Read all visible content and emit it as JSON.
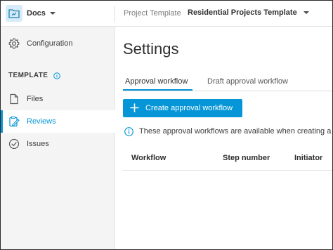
{
  "header": {
    "app_label": "Docs",
    "project_label": "Project Template",
    "project_name": "Residential Projects Template"
  },
  "sidebar": {
    "items": [
      {
        "label": "Configuration",
        "icon": "gear-icon"
      },
      {
        "label": "Files",
        "icon": "file-icon"
      },
      {
        "label": "Reviews",
        "icon": "review-icon",
        "active": true
      },
      {
        "label": "Issues",
        "icon": "check-circle-icon"
      }
    ],
    "section_label": "TEMPLATE"
  },
  "main": {
    "title": "Settings",
    "tabs": [
      {
        "label": "Approval workflow",
        "active": true
      },
      {
        "label": "Draft approval workflow"
      }
    ],
    "create_button_label": "Create approval workflow",
    "notice_text": "These approval workflows are available when creating a n",
    "table": {
      "columns": [
        "Workflow",
        "Step number",
        "Initiator"
      ]
    }
  },
  "colors": {
    "accent": "#0696d7",
    "sidebar_bg": "#f4f4f4",
    "text": "#3c3c3c"
  }
}
